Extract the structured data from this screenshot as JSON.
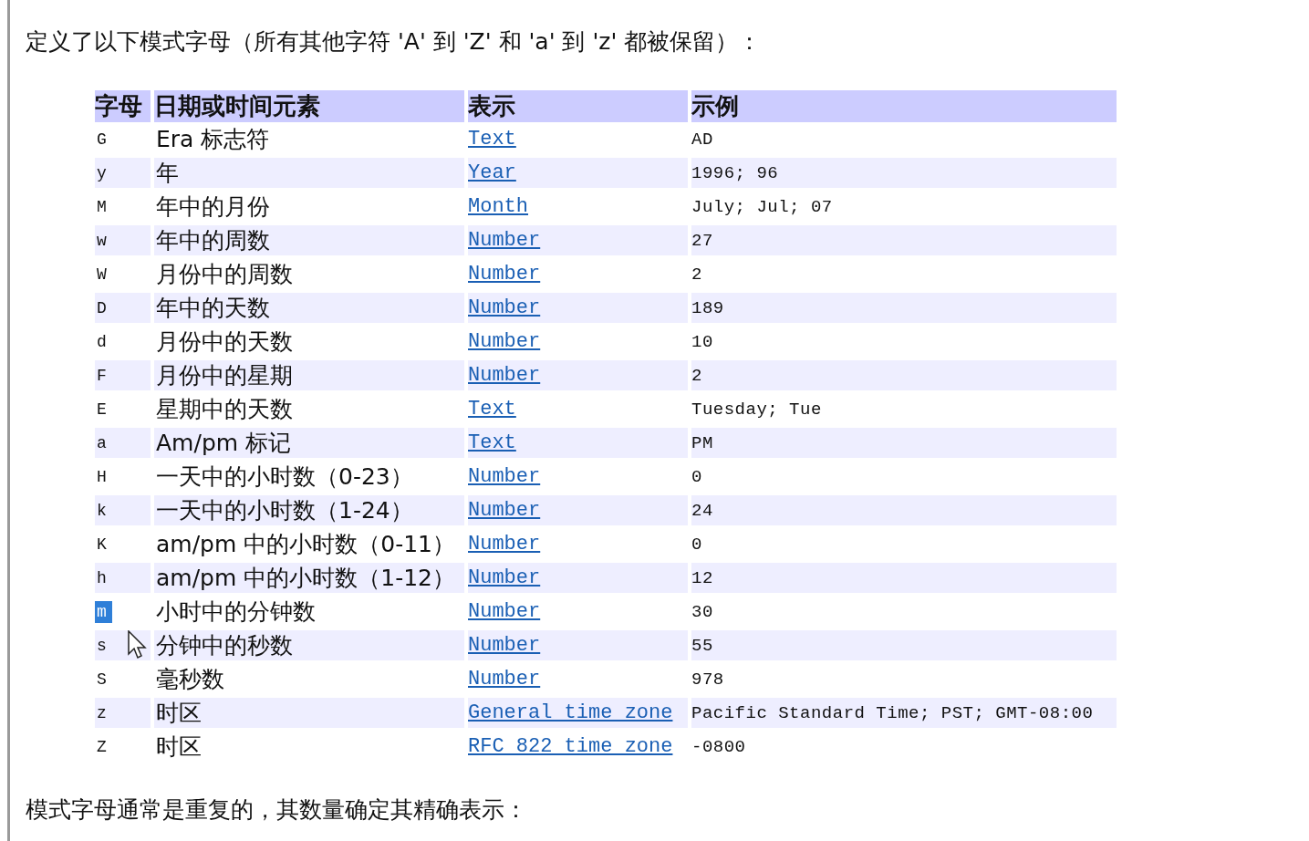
{
  "intro": "定义了以下模式字母（所有其他字符 'A' 到 'Z' 和 'a' 到 'z' 都被保留）：",
  "table": {
    "columns": [
      "字母",
      "日期或时间元素",
      "表示",
      "示例"
    ],
    "rows": [
      {
        "letter": "G",
        "element": "Era 标志符",
        "presentation": "Text",
        "example": "AD",
        "highlighted": false
      },
      {
        "letter": "y",
        "element": "年",
        "presentation": "Year",
        "example": "1996; 96",
        "highlighted": false
      },
      {
        "letter": "M",
        "element": "年中的月份",
        "presentation": "Month",
        "example": "July; Jul; 07",
        "highlighted": false
      },
      {
        "letter": "w",
        "element": "年中的周数",
        "presentation": "Number",
        "example": "27",
        "highlighted": false
      },
      {
        "letter": "W",
        "element": "月份中的周数",
        "presentation": "Number",
        "example": "2",
        "highlighted": false
      },
      {
        "letter": "D",
        "element": "年中的天数",
        "presentation": "Number",
        "example": "189",
        "highlighted": false
      },
      {
        "letter": "d",
        "element": "月份中的天数",
        "presentation": "Number",
        "example": "10",
        "highlighted": false
      },
      {
        "letter": "F",
        "element": "月份中的星期",
        "presentation": "Number",
        "example": "2",
        "highlighted": false
      },
      {
        "letter": "E",
        "element": "星期中的天数",
        "presentation": "Text",
        "example": "Tuesday; Tue",
        "highlighted": false
      },
      {
        "letter": "a",
        "element": "Am/pm 标记",
        "presentation": "Text",
        "example": "PM",
        "highlighted": false
      },
      {
        "letter": "H",
        "element": "一天中的小时数（0-23）",
        "presentation": "Number",
        "example": "0",
        "highlighted": false
      },
      {
        "letter": "k",
        "element": "一天中的小时数（1-24）",
        "presentation": "Number",
        "example": "24",
        "highlighted": false
      },
      {
        "letter": "K",
        "element": "am/pm 中的小时数（0-11）",
        "presentation": "Number",
        "example": "0",
        "highlighted": false
      },
      {
        "letter": "h",
        "element": "am/pm 中的小时数（1-12）",
        "presentation": "Number",
        "example": "12",
        "highlighted": false
      },
      {
        "letter": "m",
        "element": "小时中的分钟数",
        "presentation": "Number",
        "example": "30",
        "highlighted": true
      },
      {
        "letter": "s",
        "element": "分钟中的秒数",
        "presentation": "Number",
        "example": "55",
        "highlighted": false
      },
      {
        "letter": "S",
        "element": "毫秒数",
        "presentation": "Number",
        "example": "978",
        "highlighted": false
      },
      {
        "letter": "z",
        "element": "时区",
        "presentation": "General time zone",
        "example": "Pacific Standard Time; PST; GMT-08:00",
        "highlighted": false
      },
      {
        "letter": "Z",
        "element": "时区",
        "presentation": "RFC 822 time zone",
        "example": "-0800",
        "highlighted": false
      }
    ]
  },
  "footer": "模式字母通常是重复的，其数量确定其精确表示："
}
